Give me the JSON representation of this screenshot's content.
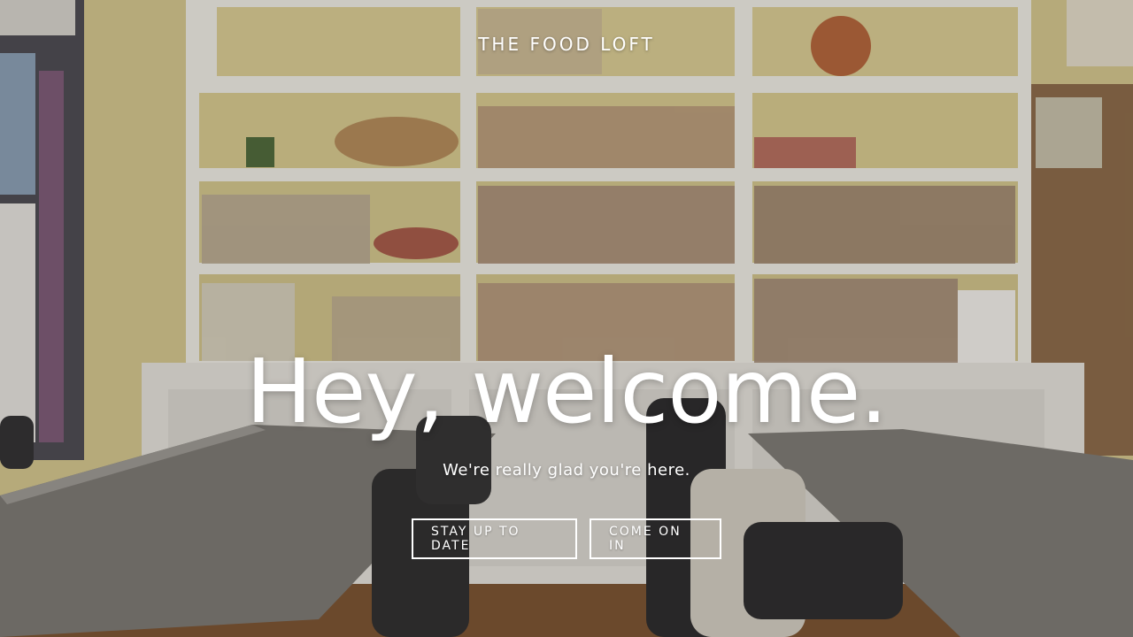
{
  "site": {
    "brand": "THE FOOD LOFT"
  },
  "hero": {
    "headline": "Hey, welcome.",
    "subhead": "We're really glad you're here.",
    "buttons": [
      {
        "label": "STAY UP TO DATE"
      },
      {
        "label": "COME ON IN"
      }
    ],
    "background_image": "library-room-with-bookshelves-and-tables"
  },
  "colors": {
    "text": "#ffffff",
    "wall": "#d9cc93",
    "shelf": "#f2f0ea",
    "table": "#7d7a76",
    "floor": "#7a5230"
  }
}
